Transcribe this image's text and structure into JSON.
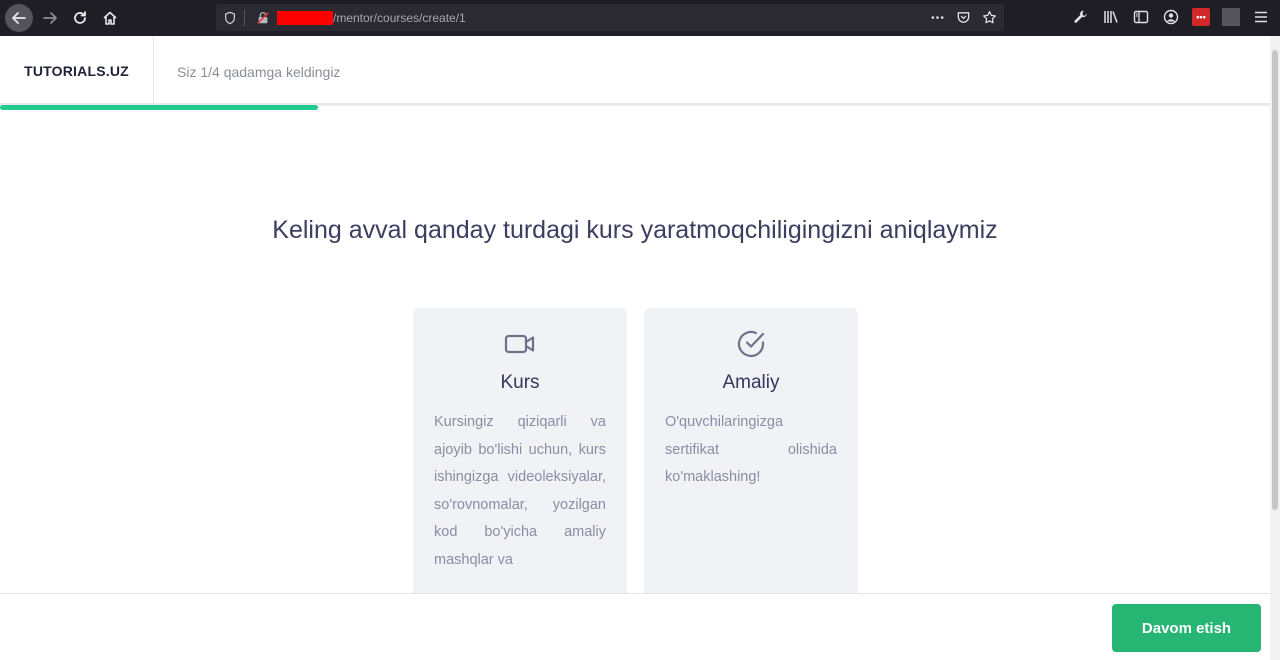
{
  "browser": {
    "url_path": "/mentor/courses/create/1"
  },
  "header": {
    "brand": "TUTORIALS.UZ",
    "step_text": "Siz 1/4 qadamga keldingiz",
    "progress_fraction": 0.25
  },
  "main": {
    "headline": "Keling avval qanday turdagi kurs yaratmoqchiligingizni aniqlaymiz",
    "cards": [
      {
        "icon": "video-camera-icon",
        "title": "Kurs",
        "description": "Kursingiz qiziqarli va ajoyib bo'lishi uchun, kurs ishingizga videoleksiyalar, so'rovnomalar, yozilgan kod bo'yicha amaliy mashqlar va"
      },
      {
        "icon": "check-circle-icon",
        "title": "Amaliy",
        "description": "O'quvchilaringizga sertifikat olishida ko'maklashing!"
      }
    ]
  },
  "footer": {
    "next_label": "Davom etish"
  },
  "colors": {
    "accent_green": "#1fcc8e",
    "button_green": "#27b574",
    "headline": "#3b3e5f"
  }
}
